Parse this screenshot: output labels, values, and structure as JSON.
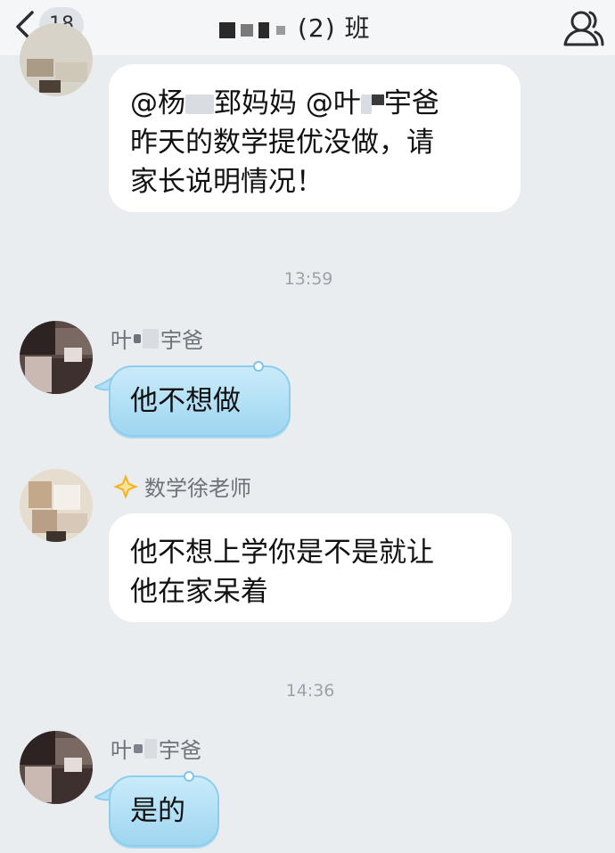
{
  "header": {
    "unread_count": "18",
    "title": "(2) 班"
  },
  "messages": [
    {
      "text_line1_a": "@杨",
      "text_line1_b": "郅妈妈 @叶",
      "text_line1_c": "宇爸",
      "text_line2": "昨天的数学提优没做，请",
      "text_line3": "家长说明情况！"
    },
    {
      "timestamp": "13:59"
    },
    {
      "sender_a": "叶",
      "sender_b": "宇爸",
      "text": "他不想做"
    },
    {
      "sender": "数学徐老师",
      "text_line1": "他不想上学你是不是就让",
      "text_line2": "他在家呆着"
    },
    {
      "timestamp": "14:36"
    },
    {
      "sender_a": "叶",
      "sender_b": "宇爸",
      "text": "是的"
    }
  ],
  "colors": {
    "background": "#e9edf0",
    "header_bg": "#f4f6f8",
    "incoming_white": "#ffffff",
    "incoming_blue": "#b7e2f6",
    "teacher_badge": "#f5b324"
  },
  "icons": {
    "back": "chevron-left-icon",
    "profile": "group-members-icon",
    "teacher_badge": "diamond-star-icon"
  }
}
